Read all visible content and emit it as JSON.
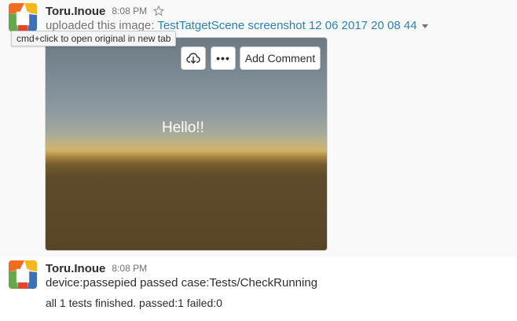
{
  "messages": [
    {
      "username": "Toru.Inoue",
      "timestamp": "8:08 PM",
      "uploaded_prefix": "uploaded this image: ",
      "file_name": "TestTatgetScene screenshot 12 06 2017 20 08 44",
      "tooltip": "cmd+click to open original in new tab",
      "image": {
        "overlay_text": "Hello!!",
        "actions": {
          "comment_label": "Add Comment",
          "more_label": "•••"
        }
      }
    },
    {
      "username": "Toru.Inoue",
      "timestamp": "8:08 PM",
      "lines": [
        "device:passepied passed case:Tests/CheckRunning",
        "all 1 tests finished. passed:1 failed:0"
      ]
    }
  ],
  "icons": {
    "avatar": "avatar-icon",
    "star": "star-icon",
    "caret": "caret-down-icon",
    "download": "cloud-download-icon"
  },
  "colors": {
    "link": "#2a80b9",
    "secondary_text": "#717274",
    "avatar_orange": "#f26b22",
    "avatar_yellow": "#f6b71c",
    "avatar_green": "#63a94a",
    "avatar_blue": "#3c71b7"
  }
}
